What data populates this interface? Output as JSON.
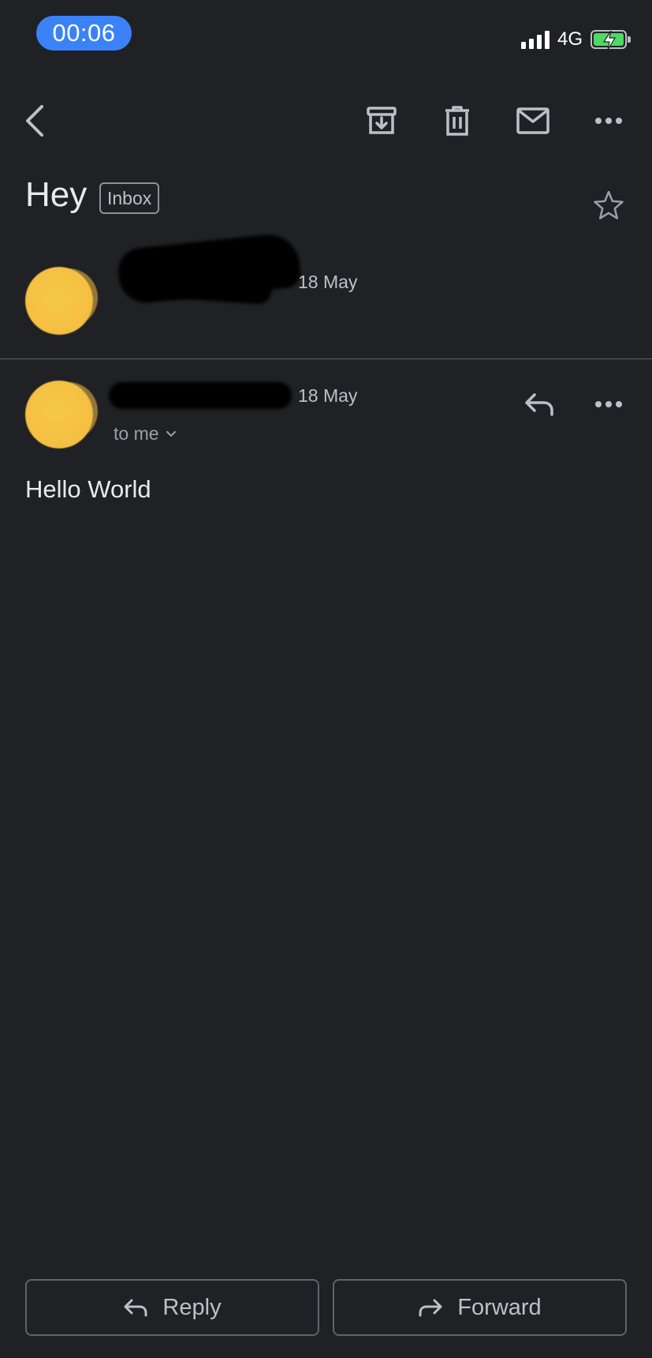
{
  "status_bar": {
    "time": "00:06",
    "network": "4G"
  },
  "toolbar": {
    "icons": [
      "back-icon",
      "archive-icon",
      "trash-icon",
      "mail-icon",
      "more-icon"
    ]
  },
  "subject": {
    "title": "Hey",
    "label": "Inbox"
  },
  "thread": [
    {
      "date": "18 May"
    },
    {
      "date": "18 May",
      "recipient": "to me"
    }
  ],
  "message": {
    "body": "Hello World"
  },
  "actions": {
    "reply_label": "Reply",
    "forward_label": "Forward"
  },
  "colors": {
    "background": "#202124",
    "time_pill": "#3b82f6",
    "avatar": "#f5c043",
    "battery": "#4cd964"
  }
}
